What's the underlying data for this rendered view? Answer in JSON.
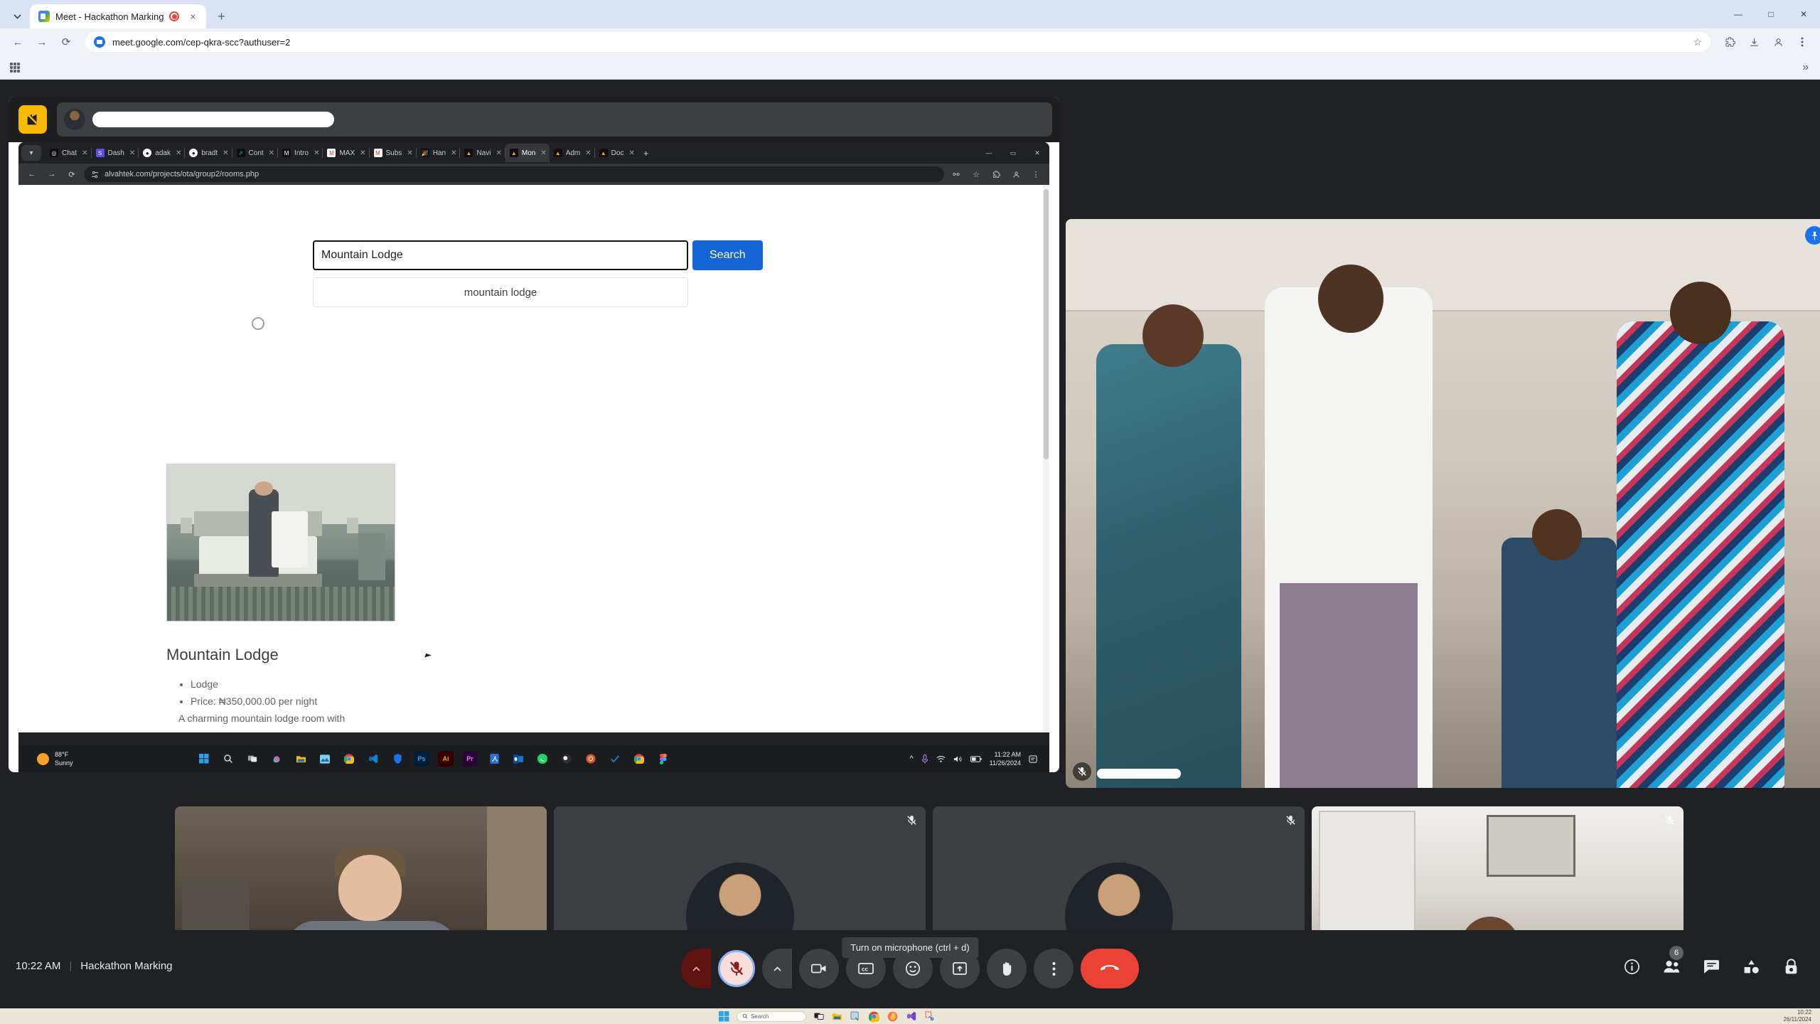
{
  "outer_browser": {
    "tab": {
      "title": "Meet - Hackathon Marking",
      "favicon": "google-meet-icon",
      "recording_indicator": "recording-icon",
      "close": "×"
    },
    "new_tab_label": "+",
    "window_buttons": {
      "minimize": "—",
      "maximize": "□",
      "close": "✕"
    },
    "nav": {
      "back": "←",
      "forward": "→",
      "reload": "⟳"
    },
    "omnibox": {
      "url": "meet.google.com/cep-qkra-scc?authuser=2",
      "site_icon": "meet-site-icon",
      "bookmark_star": "☆"
    },
    "toolbar_icons": {
      "extensions": "puzzle-icon",
      "downloads": "download-icon",
      "profile": "profile-icon",
      "menu": "kebab-menu-icon"
    },
    "bookmarks_bar": {
      "apps_icon": "apps-grid-icon",
      "overflow": "»"
    }
  },
  "meet": {
    "meeting_time": "10:22 AM",
    "meeting_name": "Hackathon Marking",
    "tooltip": "Turn on microphone (ctrl + d)",
    "controls": [
      {
        "name": "mic-options",
        "icon": "chevron-up-icon"
      },
      {
        "name": "microphone-toggle",
        "icon": "mic-off-icon",
        "state": "muted"
      },
      {
        "name": "camera-options",
        "icon": "chevron-up-icon"
      },
      {
        "name": "camera-toggle",
        "icon": "camera-icon"
      },
      {
        "name": "captions-toggle",
        "icon": "closed-captions-icon"
      },
      {
        "name": "reactions",
        "icon": "emoji-smile-icon"
      },
      {
        "name": "present-now",
        "icon": "present-screen-icon"
      },
      {
        "name": "raise-hand",
        "icon": "raised-hand-icon"
      },
      {
        "name": "more-options",
        "icon": "kebab-menu-icon"
      },
      {
        "name": "leave-call",
        "icon": "end-call-icon"
      }
    ],
    "right_controls": [
      {
        "name": "meeting-details",
        "icon": "info-icon"
      },
      {
        "name": "participants",
        "icon": "people-icon",
        "badge": "6"
      },
      {
        "name": "chat",
        "icon": "chat-bubble-icon"
      },
      {
        "name": "activities",
        "icon": "activities-shapes-icon"
      },
      {
        "name": "host-controls",
        "icon": "lock-shield-icon"
      }
    ],
    "self_view": {
      "pin_icon": "pin-icon",
      "mic_icon": "mic-off-icon"
    },
    "participants": [
      {
        "name": "participant-tile-1",
        "type": "webcam",
        "mic": ""
      },
      {
        "name": "participant-tile-2",
        "type": "avatar",
        "mic": "mic-off-icon"
      },
      {
        "name": "participant-tile-3",
        "type": "avatar",
        "mic": "mic-off-icon"
      },
      {
        "name": "participant-tile-4",
        "type": "webcam",
        "mic": "mic-off-icon"
      }
    ]
  },
  "shared_screen": {
    "presenter_bar": {
      "stop_share_icon": "stop-presenting-icon"
    },
    "inner_browser": {
      "tab_search_icon": "chevron-down-icon",
      "tabs": [
        {
          "label": "Chat",
          "favicon": "chatgpt-icon",
          "fav_bg": "#0f0f0f",
          "fav_text": "◎",
          "active": false
        },
        {
          "label": "Dash",
          "favicon": "supabase-icon",
          "fav_bg": "#5b4bec",
          "fav_text": "S",
          "active": false
        },
        {
          "label": "adak",
          "favicon": "github-icon",
          "fav_bg": "#0f0f0f",
          "fav_text": "",
          "active": false
        },
        {
          "label": "bradt",
          "favicon": "github-icon",
          "fav_bg": "#0f0f0f",
          "fav_text": "",
          "active": false
        },
        {
          "label": "Cont",
          "favicon": "notion-icon",
          "fav_bg": "#0f0f0f",
          "fav_text": "⇗",
          "active": false
        },
        {
          "label": "Intro",
          "favicon": "medium-icon",
          "fav_bg": "#0f0f0f",
          "fav_text": "M",
          "active": false
        },
        {
          "label": "MAX",
          "favicon": "gmail-icon",
          "fav_bg": "#ffffff",
          "fav_text": "M",
          "active": false
        },
        {
          "label": "Subs",
          "favicon": "gmail-icon",
          "fav_bg": "#ffffff",
          "fav_text": "M",
          "active": false
        },
        {
          "label": "Han",
          "favicon": "party-popper-icon",
          "fav_bg": "#0f0f0f",
          "fav_text": "🎉",
          "active": false
        },
        {
          "label": "Navi",
          "favicon": "firebase-icon",
          "fav_bg": "#0f0f0f",
          "fav_text": "▲",
          "active": false
        },
        {
          "label": "Mon",
          "favicon": "firebase-icon",
          "fav_bg": "#0f0f0f",
          "fav_text": "▲",
          "active": true
        },
        {
          "label": "Adm",
          "favicon": "firebase-icon",
          "fav_bg": "#0f0f0f",
          "fav_text": "▲",
          "active": false
        },
        {
          "label": "Doc",
          "favicon": "firebase-icon",
          "fav_bg": "#0f0f0f",
          "fav_text": "▲",
          "active": false
        }
      ],
      "new_tab": "+",
      "window_buttons": {
        "minimize": "—",
        "maximize": "▭",
        "close": "✕"
      },
      "nav": {
        "back": "←",
        "forward": "→",
        "reload": "⟳"
      },
      "url": "alvahtek.com/projects/ota/group2/rooms.php",
      "site_icon": "site-settings-icon",
      "toolbar_icons": {
        "translate": "translate-icon",
        "bookmark": "star-icon",
        "extensions": "puzzle-icon",
        "profile": "profile-icon",
        "menu": "kebab-menu-icon"
      }
    },
    "page": {
      "search": {
        "value": "Mountain Lodge",
        "button_label": "Search",
        "button_color": "#1565d8"
      },
      "suggestion": "mountain lodge",
      "room": {
        "image_alt": "mountain-lodge-room-photo",
        "title": "Mountain Lodge",
        "bullets": [
          "Lodge",
          "Price: ₦350,000.00 per night"
        ],
        "description": "A charming mountain lodge room with"
      }
    },
    "taskbar": {
      "weather": {
        "temperature": "88°F",
        "condition": "Sunny"
      },
      "icons": [
        {
          "name": "start-button",
          "icon": "windows-logo-icon"
        },
        {
          "name": "search-button",
          "icon": "search-icon"
        },
        {
          "name": "task-view-button",
          "icon": "task-view-icon"
        },
        {
          "name": "copilot-button",
          "icon": "copilot-icon"
        },
        {
          "name": "file-explorer-button",
          "icon": "folder-icon"
        },
        {
          "name": "photos-button",
          "icon": "photos-icon"
        },
        {
          "name": "chrome-button",
          "icon": "chrome-icon"
        },
        {
          "name": "vscode-button",
          "icon": "vscode-icon"
        },
        {
          "name": "bitwarden-button",
          "icon": "shield-icon"
        },
        {
          "name": "photoshop-button",
          "icon": "ps-icon",
          "label": "Ps"
        },
        {
          "name": "illustrator-button",
          "icon": "ai-icon",
          "label": "Ai"
        },
        {
          "name": "premiere-button",
          "icon": "pr-icon",
          "label": "Pr"
        },
        {
          "name": "acrobat-button",
          "icon": "acrobat-icon"
        },
        {
          "name": "outlook-button",
          "icon": "outlook-icon"
        },
        {
          "name": "whatsapp-button",
          "icon": "whatsapp-icon"
        },
        {
          "name": "obs-button",
          "icon": "obs-icon"
        },
        {
          "name": "ubuntu-button",
          "icon": "ubuntu-icon"
        },
        {
          "name": "todo-button",
          "icon": "check-icon"
        },
        {
          "name": "chrome2-button",
          "icon": "chrome-icon"
        },
        {
          "name": "figma-button",
          "icon": "figma-icon"
        }
      ],
      "tray": {
        "overflow": "chevron-up-icon",
        "mic": "mic-icon",
        "wifi": "wifi-icon",
        "volume": "volume-icon",
        "battery": "battery-icon",
        "time": "11:22 AM",
        "date": "11/26/2024",
        "notification": "notification-icon"
      }
    }
  },
  "windows_taskbar": {
    "start": "windows-logo-icon",
    "search_placeholder": "Search",
    "search_icon": "search-icon",
    "icons": [
      {
        "name": "task-view-button",
        "icon": "task-view-icon"
      },
      {
        "name": "file-explorer-button",
        "icon": "folder-icon"
      },
      {
        "name": "bitwarden-button",
        "icon": "shield-lock-icon"
      },
      {
        "name": "chrome-button",
        "icon": "chrome-icon",
        "active": true
      },
      {
        "name": "firefox-button",
        "icon": "firefox-icon"
      },
      {
        "name": "vscode-button",
        "icon": "vscode-icon"
      },
      {
        "name": "snipping-tool-button",
        "icon": "scissors-icon"
      }
    ],
    "clock": {
      "time": "10:22",
      "date": "26/11/2024"
    }
  }
}
